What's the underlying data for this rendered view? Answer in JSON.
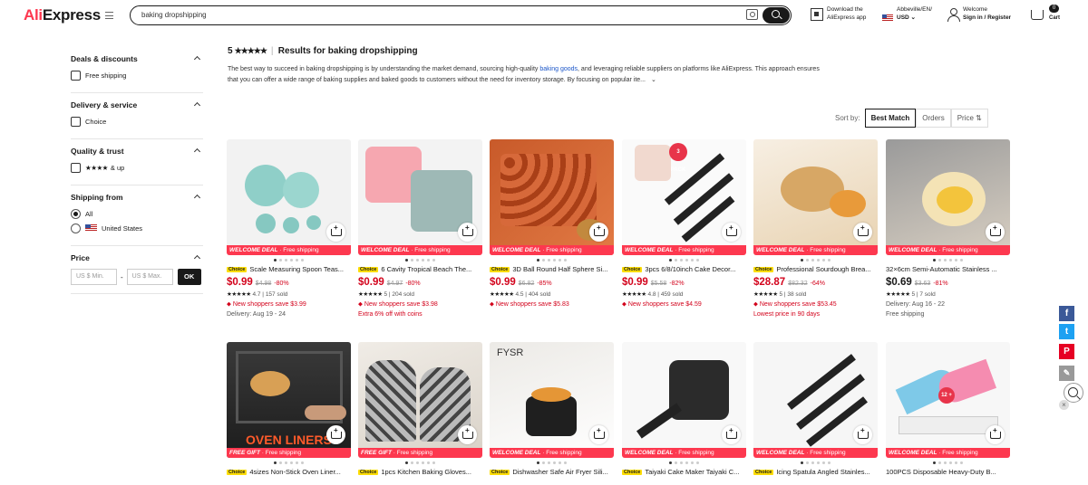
{
  "header": {
    "logo_a": "Ali",
    "logo_b": "Express",
    "search_value": "baking dropshipping",
    "app_line1": "Download the",
    "app_line2": "AliExpress app",
    "region_line1": "Abbeville/EN/",
    "region_line2": "USD",
    "welcome": "Welcome",
    "signin": "Sign in / Register",
    "cart_count": "0",
    "cart_label": "Cart"
  },
  "sidebar": {
    "deals_title": "Deals & discounts",
    "free_shipping": "Free shipping",
    "delivery_title": "Delivery & service",
    "choice": "Choice",
    "quality_title": "Quality & trust",
    "stars": "★★★★",
    "stars_up": "& up",
    "shipfrom_title": "Shipping from",
    "all": "All",
    "us": "United States",
    "price_title": "Price",
    "min_ph": "US $ Min.",
    "max_ph": "US $ Max.",
    "dash": "-",
    "ok": "OK"
  },
  "results": {
    "rating_num": "5",
    "rating_stars": "★★★★★",
    "title": "Results for baking dropshipping",
    "desc_1": "The best way to succeed in baking dropshipping is by understanding the market demand, sourcing high-quality ",
    "desc_link": "baking goods",
    "desc_2": ", and leveraging reliable suppliers on platforms like AliExpress. This approach ensures that you can offer a wide range of baking supplies and baked goods to customers without the need for inventory storage. By focusing on popular ite...",
    "more": "⌄"
  },
  "sort": {
    "label": "Sort by:",
    "best": "Best Match",
    "orders": "Orders",
    "price": "Price ⇅"
  },
  "products": [
    {
      "title": "Scale Measuring Spoon Teas...",
      "choice": "Choice",
      "price": "$0.99",
      "orig": "$4.98",
      "off": "-80%",
      "rating": "★★★★★",
      "score": "4.7",
      "sold": "157 sold",
      "promo": "New shoppers save $3.99",
      "extra": "Delivery: Aug 19 - 24",
      "deal": "WELCOME DEAL",
      "ship": "Free shipping"
    },
    {
      "title": "6 Cavity Tropical Beach The...",
      "choice": "Choice",
      "price": "$0.99",
      "orig": "$4.97",
      "off": "-80%",
      "rating": "★★★★★",
      "score": "5",
      "sold": "204 sold",
      "promo": "New shoppers save $3.98",
      "extra": "Extra 6% off with coins",
      "deal": "WELCOME DEAL",
      "ship": "Free shipping"
    },
    {
      "title": "3D Ball Round Half Sphere Si...",
      "choice": "Choice",
      "price": "$0.99",
      "orig": "$6.82",
      "off": "-85%",
      "rating": "★★★★★",
      "score": "4.5",
      "sold": "404 sold",
      "promo": "New shoppers save $5.83",
      "extra": "",
      "deal": "WELCOME DEAL",
      "ship": "Free shipping"
    },
    {
      "title": "3pcs 6/8/10inch Cake Decor...",
      "choice": "Choice",
      "price": "$0.99",
      "orig": "$5.58",
      "off": "-82%",
      "rating": "★★★★★",
      "score": "4.8",
      "sold": "459 sold",
      "promo": "New shoppers save $4.59",
      "extra": "",
      "deal": "WELCOME DEAL",
      "ship": "Free shipping"
    },
    {
      "title": "Professional Sourdough Brea...",
      "choice": "Choice",
      "price": "$28.87",
      "orig": "$82.32",
      "off": "-64%",
      "rating": "★★★★★",
      "score": "5",
      "sold": "38 sold",
      "promo": "New shoppers save $53.45",
      "extra": "Lowest price in 90 days",
      "deal": "WELCOME DEAL",
      "ship": "Free shipping"
    },
    {
      "title": "32×6cm Semi-Automatic Stainless ...",
      "choice": "",
      "price": "$0.69",
      "orig": "$3.63",
      "off": "-81%",
      "rating": "★★★★★",
      "score": "5",
      "sold": "7 sold",
      "promo": "Delivery: Aug 16 - 22",
      "extra": "Free shipping",
      "deal": "WELCOME DEAL",
      "ship": "Free shipping"
    },
    {
      "title": "4sizes Non-Stick Oven Liner...",
      "choice": "Choice",
      "deal": "FREE GIFT",
      "ship": "Free shipping",
      "overlay": "OVEN LINERS"
    },
    {
      "title": "1pcs Kitchen Baking Gloves...",
      "choice": "Choice",
      "deal": "FREE GIFT",
      "ship": "Free shipping"
    },
    {
      "title": "Dishwasher Safe Air Fryer Sili...",
      "choice": "Choice",
      "deal": "WELCOME DEAL",
      "ship": "Free shipping",
      "overlay": "FYSR"
    },
    {
      "title": "Taiyaki Cake Maker Taiyaki C...",
      "choice": "Choice",
      "deal": "WELCOME DEAL",
      "ship": "Free shipping"
    },
    {
      "title": "Icing Spatula Angled Stainles...",
      "choice": "Choice",
      "deal": "WELCOME DEAL",
      "ship": "Free shipping"
    },
    {
      "title": "100PCS Disposable Heavy-Duty B...",
      "choice": "",
      "deal": "WELCOME DEAL",
      "ship": "Free shipping"
    }
  ],
  "badges": {
    "pack": "3 PACK",
    "gift": "12 +"
  },
  "share": {
    "fb": "f",
    "tw": "t",
    "pin": "P",
    "close": "×"
  },
  "colors": {
    "brand": "#fd384f",
    "price": "#d3031c",
    "choice": "#fddd06"
  }
}
